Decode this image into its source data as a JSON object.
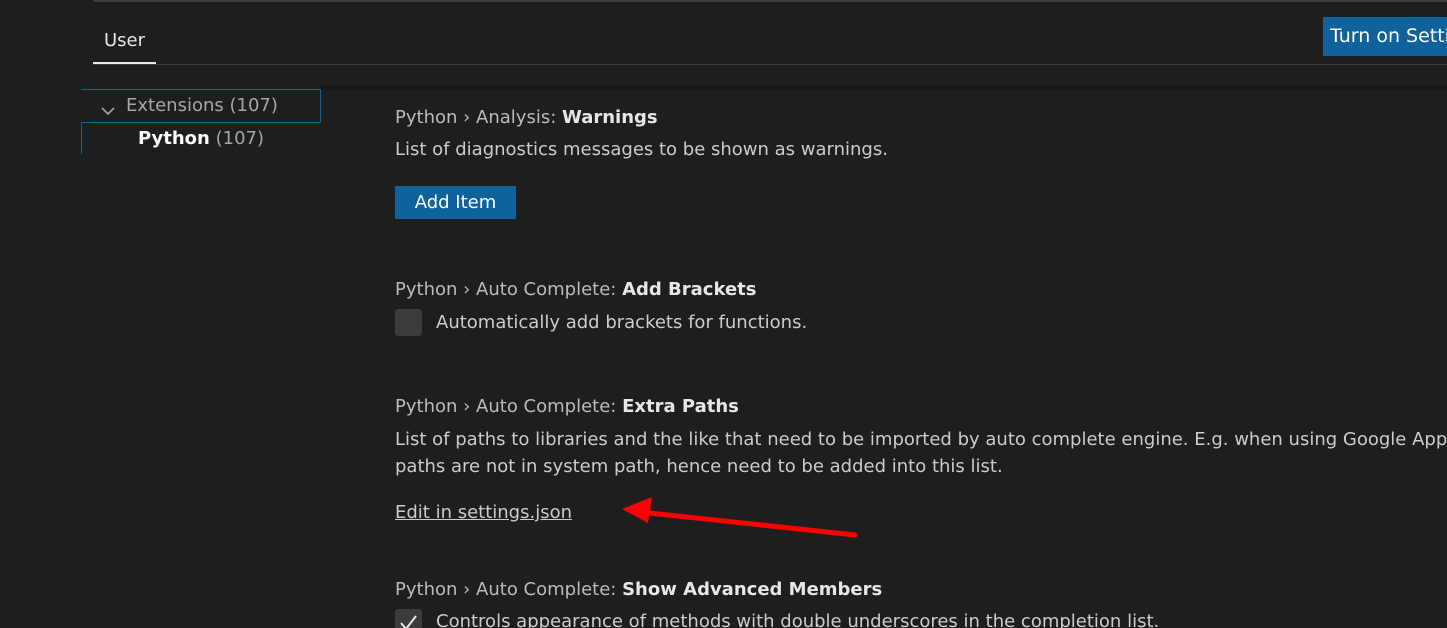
{
  "tabs": {
    "user_label": "User"
  },
  "header": {
    "sync_button_label": "Turn on Settings Sync"
  },
  "toc": {
    "extensions": {
      "label": "Extensions (107)"
    },
    "python": {
      "name": "Python",
      "count": "(107)"
    }
  },
  "settings": [
    {
      "category": "Python › Analysis: ",
      "name": "Warnings",
      "description": "List of diagnostics messages to be shown as warnings.",
      "button_label": "Add Item"
    },
    {
      "category": "Python › Auto Complete: ",
      "name": "Add Brackets",
      "description": "Automatically add brackets for functions.",
      "checked": false
    },
    {
      "category": "Python › Auto Complete: ",
      "name": "Extra Paths",
      "description_line1": "List of paths to libraries and the like that need to be imported by auto complete engine. E.g. when using Google App SDK, t",
      "description_line2": "paths are not in system path, hence need to be added into this list.",
      "link_label": "Edit in settings.json"
    },
    {
      "category": "Python › Auto Complete: ",
      "name": "Show Advanced Members",
      "description": "Controls appearance of methods with double underscores in the completion list.",
      "checked": true
    }
  ],
  "colors": {
    "background": "#1e1e1e",
    "accent": "#0e639c",
    "annotation_arrow": "#ff0000"
  },
  "icons": {
    "chevron": "chevron-down-icon",
    "check": "check-icon",
    "annotation": "red-arrow-annotation"
  }
}
